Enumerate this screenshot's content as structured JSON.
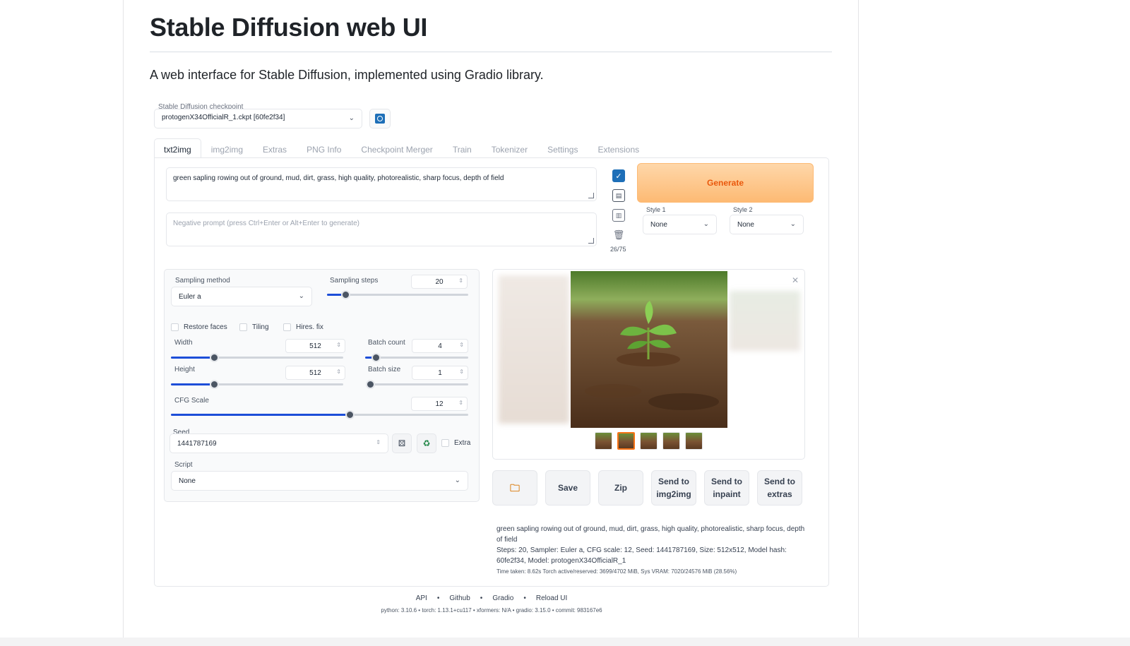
{
  "readme": {
    "title": "Stable Diffusion web UI",
    "description": "A web interface for Stable Diffusion, implemented using Gradio library."
  },
  "checkpoint": {
    "label": "Stable Diffusion checkpoint",
    "value": "protogenX34OfficialR_1.ckpt [60fe2f34]"
  },
  "tabs": [
    "txt2img",
    "img2img",
    "Extras",
    "PNG Info",
    "Checkpoint Merger",
    "Train",
    "Tokenizer",
    "Settings",
    "Extensions"
  ],
  "prompt": {
    "value": "green sapling rowing out of ground, mud, dirt, grass, high quality, photorealistic, sharp focus, depth of field",
    "negative_placeholder": "Negative prompt (press Ctrl+Enter or Alt+Enter to generate)",
    "token_count": "26/75"
  },
  "generate_label": "Generate",
  "styles": {
    "style1_label": "Style 1",
    "style1_value": "None",
    "style2_label": "Style 2",
    "style2_value": "None"
  },
  "settings": {
    "sampling_method_label": "Sampling method",
    "sampling_method_value": "Euler a",
    "sampling_steps_label": "Sampling steps",
    "sampling_steps_value": "20",
    "sampling_steps_fraction": 0.13,
    "restore_faces_label": "Restore faces",
    "tiling_label": "Tiling",
    "hires_fix_label": "Hires. fix",
    "width_label": "Width",
    "width_value": "512",
    "width_fraction": 0.25,
    "height_label": "Height",
    "height_value": "512",
    "height_fraction": 0.25,
    "batch_count_label": "Batch count",
    "batch_count_value": "4",
    "batch_count_fraction": 0.1,
    "batch_size_label": "Batch size",
    "batch_size_value": "1",
    "batch_size_fraction": 0.0,
    "cfg_label": "CFG Scale",
    "cfg_value": "12",
    "cfg_fraction": 0.6,
    "seed_label": "Seed",
    "seed_value": "1441787169",
    "extra_label": "Extra",
    "script_label": "Script",
    "script_value": "None"
  },
  "actions": {
    "save": "Save",
    "zip": "Zip",
    "send_img2img_1": "Send to",
    "send_img2img_2": "img2img",
    "send_inpaint_1": "Send to",
    "send_inpaint_2": "inpaint",
    "send_extras_1": "Send to",
    "send_extras_2": "extras"
  },
  "info": {
    "prompt": "green sapling rowing out of ground, mud, dirt, grass, high quality, photorealistic, sharp focus, depth of field",
    "params": "Steps: 20, Sampler: Euler a, CFG scale: 12, Seed: 1441787169, Size: 512x512, Model hash: 60fe2f34, Model: protogenX34OfficialR_1",
    "timing": "Time taken: 8.62s  Torch active/reserved: 3699/4702 MiB, Sys VRAM: 7020/24576 MiB (28.56%)"
  },
  "footer": {
    "api": "API",
    "github": "Github",
    "gradio": "Gradio",
    "reload": "Reload UI",
    "sep": "•",
    "versions": "python: 3.10.6  •  torch: 1.13.1+cu117  •  xformers: N/A  •  gradio: 3.15.0  •  commit: 983167e6"
  },
  "colors": {
    "accent_blue": "#1d4ed8",
    "generate_orange": "#ea580c",
    "generate_bg": "#fdba74"
  }
}
